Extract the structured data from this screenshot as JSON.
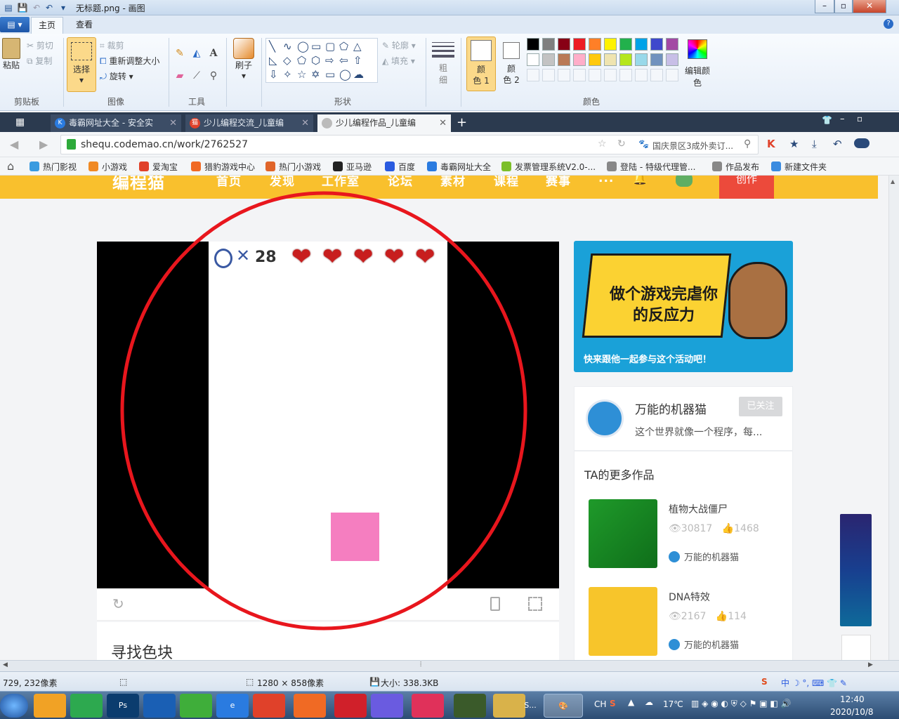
{
  "window": {
    "title": "无标题.png - 画图"
  },
  "ribbon": {
    "tabs": [
      "主页",
      "查看"
    ],
    "clipboard": {
      "paste": "粘贴",
      "cut": "剪切",
      "copy": "复制",
      "label": "剪贴板"
    },
    "image": {
      "select": "选择",
      "crop": "裁剪",
      "resize": "重新调整大小",
      "rotate": "旋转",
      "label": "图像"
    },
    "tools": {
      "label": "工具",
      "text_tool": "A"
    },
    "brush": {
      "label": "刷子"
    },
    "shapes": {
      "outline": "轮廓",
      "fill": "填充",
      "label": "形状"
    },
    "size": {
      "label": "粗\n细"
    },
    "colors": {
      "color1": "颜\n色 1",
      "color2": "颜\n色 2",
      "edit": "编辑颜色",
      "label": "颜色",
      "row1": [
        "#000000",
        "#7f7f7f",
        "#880015",
        "#ed1c24",
        "#ff7f27",
        "#fff200",
        "#22b14c",
        "#00a2e8",
        "#3f48cc",
        "#a349a4"
      ],
      "row2": [
        "#ffffff",
        "#c3c3c3",
        "#b97a57",
        "#ffaec9",
        "#ffc90e",
        "#efe4b0",
        "#b5e61d",
        "#99d9ea",
        "#7092be",
        "#c8bfe7"
      ]
    }
  },
  "browser": {
    "tabs": [
      {
        "label": "毒霸网址大全 - 安全实",
        "fav": "K",
        "color": "#2a7be0"
      },
      {
        "label": "少儿编程交流_儿童编",
        "fav": "猫",
        "color": "#e0412a"
      },
      {
        "label": "少儿编程作品_儿童编",
        "fav": "",
        "color": "#bbbbbb"
      }
    ],
    "new_tab": "+",
    "url": "shequ.codemao.cn/work/2762527",
    "search_hint": "国庆景区3成外卖订...",
    "bookmarks": [
      {
        "label": "热门影视",
        "color": "#3a9be0"
      },
      {
        "label": "小游戏",
        "color": "#f08a24"
      },
      {
        "label": "爱淘宝",
        "color": "#e0412a"
      },
      {
        "label": "猎豹游戏中心",
        "color": "#f06a24"
      },
      {
        "label": "热门小游戏",
        "color": "#e0652a"
      },
      {
        "label": "亚马逊",
        "color": "#222222"
      },
      {
        "label": "百度",
        "color": "#2a5be0"
      },
      {
        "label": "毒霸网址大全",
        "color": "#2a7be0"
      },
      {
        "label": "发票管理系统V2.0-...",
        "color": "#7cbf2a"
      },
      {
        "label": "登陆 - 特级代理管...",
        "color": "#888888"
      },
      {
        "label": "作品发布",
        "color": "#888888"
      },
      {
        "label": "新建文件夹",
        "color": "#3a8be0"
      }
    ]
  },
  "site": {
    "logo": "编程猫",
    "nav": [
      "首页",
      "发现",
      "工作室",
      "论坛",
      "素材",
      "课程",
      "赛事",
      "..."
    ],
    "create": "创作",
    "game": {
      "timer": "28",
      "hearts": 5
    },
    "work_title": "寻找色块",
    "banner": {
      "headline": "做个游戏完虐你\n的反应力",
      "sub": "快来跟他一起参与这个活动吧！"
    },
    "author": {
      "name": "万能的机器猫",
      "bio": "这个世界就像一个程序，每...",
      "follow": "已关注"
    },
    "more_title": "TA的更多作品",
    "works": [
      {
        "name": "植物大战僵尸",
        "views": "30817",
        "likes": "1468",
        "author": "万能的机器猫"
      },
      {
        "name": "DNA特效",
        "views": "2167",
        "likes": "114",
        "author": "万能的机器猫"
      }
    ]
  },
  "status": {
    "cursor": "729, 232像素",
    "dimensions": "1280 × 858像素",
    "size": "大小: 338.3KB"
  },
  "taskbar": {
    "apps": [
      "S..."
    ],
    "lang": "CH",
    "temp": "17℃",
    "time": "12:40",
    "date": "2020/10/8"
  },
  "annotation": {
    "color": "#e8161d"
  }
}
